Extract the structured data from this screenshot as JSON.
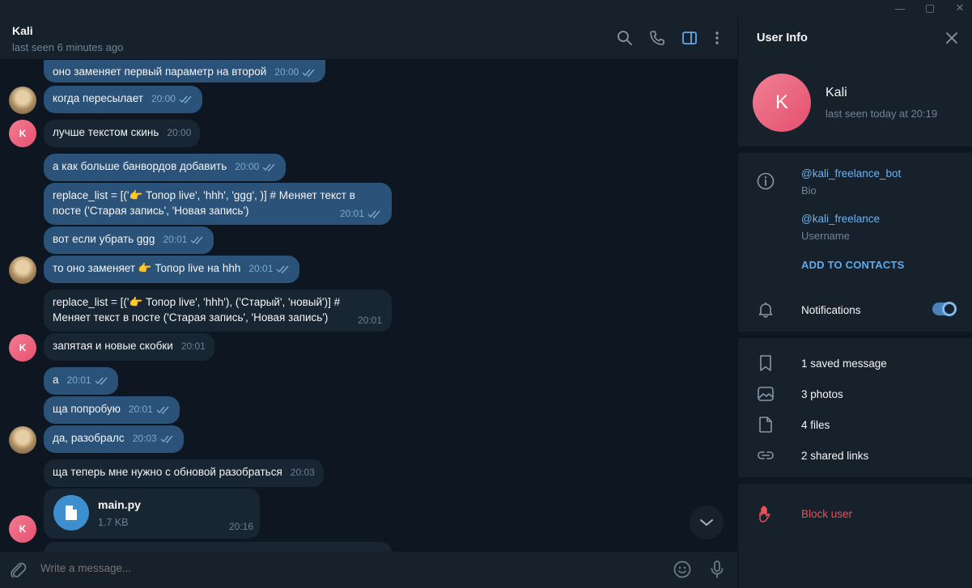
{
  "window": {
    "minimize": "—",
    "maximize": "▢",
    "close": "✕"
  },
  "chat": {
    "title": "Kali",
    "status": "last seen 6 minutes ago"
  },
  "messages": [
    {
      "text": "оно заменяет первый параметр на второй",
      "time": "20:00",
      "dir": "out"
    },
    {
      "text": "когда пересылает",
      "time": "20:00",
      "dir": "out"
    },
    {
      "text": "лучше текстом скинь",
      "time": "20:00",
      "dir": "in"
    },
    {
      "text": "а как больше банвордов добавить",
      "time": "20:00",
      "dir": "out"
    },
    {
      "text": "replace_list = [('👉 Топор live', 'hhh', 'ggg', )]  # Меняет текст в посте ('Старая запись', 'Новая запись')",
      "time": "20:01",
      "dir": "out"
    },
    {
      "text": "вот если убрать ggg",
      "time": "20:01",
      "dir": "out"
    },
    {
      "text": "то оно заменяет 👉 Топор live на hhh",
      "time": "20:01",
      "dir": "out"
    },
    {
      "text": "replace_list = [('👉 Топор live', 'hhh'), ('Старый', 'новый')]  # Меняет текст в посте ('Старая запись', 'Новая запись')",
      "time": "20:01",
      "dir": "in"
    },
    {
      "text": "запятая и новые скобки",
      "time": "20:01",
      "dir": "in"
    },
    {
      "text": "а",
      "time": "20:01",
      "dir": "out"
    },
    {
      "text": "ща попробую",
      "time": "20:01",
      "dir": "out"
    },
    {
      "text": "да, разобралс",
      "time": "20:03",
      "dir": "out"
    },
    {
      "text": "ща теперь мне нужно с обновой разобраться",
      "time": "20:03",
      "dir": "in"
    }
  ],
  "file": {
    "name": "main.py",
    "size": "1.7 KB",
    "time": "20:16"
  },
  "avatar_letter": "K",
  "composer": {
    "placeholder": "Write a message..."
  },
  "panel": {
    "title": "User Info",
    "name": "Kali",
    "status": "last seen today at 20:19",
    "avatar_letter": "K",
    "bio_value": "@kali_freelance_bot",
    "bio_label": "Bio",
    "username_value": "@kali_freelance",
    "username_label": "Username",
    "add_contacts": "ADD TO CONTACTS",
    "notifications": "Notifications",
    "notifications_on": true,
    "saved": "1 saved message",
    "photos": "3 photos",
    "files": "4 files",
    "links": "2 shared links",
    "block": "Block user"
  },
  "colors": {
    "accent": "#6ab3f3",
    "out_bubble": "#2b5278",
    "in_bubble": "#182533",
    "danger": "#e5535b"
  }
}
